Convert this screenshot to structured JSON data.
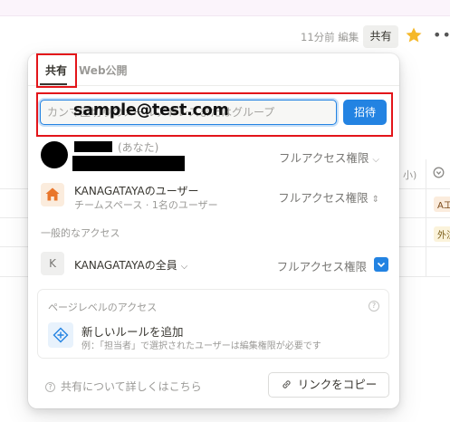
{
  "topbar": {
    "edited_text": "11分前 編集",
    "share_label": "共有",
    "more_label": "•••"
  },
  "background": {
    "cell_header_fragment": "小)",
    "tag_1": "A工",
    "tag_2": "外注"
  },
  "popup": {
    "tabs": [
      {
        "label": "共有",
        "active": true
      },
      {
        "label": "Web公開",
        "active": false
      }
    ],
    "invite": {
      "placeholder": "カンマ区切りのメールアドレスまたはグループ",
      "overlay_value": "sample@test.com",
      "button_label": "招待"
    },
    "members": [
      {
        "name_suffix": "(あなた)",
        "access": "フルアクセス権限"
      },
      {
        "name": "KANAGATAYAのユーザー",
        "sub": "チームスペース · 1名のユーザー",
        "access": "フルアクセス権限"
      }
    ],
    "general_section_label": "一般的なアクセス",
    "general_access": {
      "avatar_letter": "K",
      "name": "KANAGATAYAの全員",
      "access": "フルアクセス権限"
    },
    "page_access": {
      "title": "ページレベルのアクセス",
      "help_glyph": "?",
      "rule_title": "新しいルールを追加",
      "rule_desc": "例：「担当者」で選択されたユーザーは編集権限が必要です"
    },
    "footer": {
      "help_text": "共有について詳しくはこちら",
      "copy_link_label": "リンクをコピー"
    }
  },
  "colors": {
    "accent_blue": "#2383e2",
    "annotation_red": "#e3151a",
    "star_yellow": "#f5b829",
    "house_orange": "#e9762b"
  }
}
